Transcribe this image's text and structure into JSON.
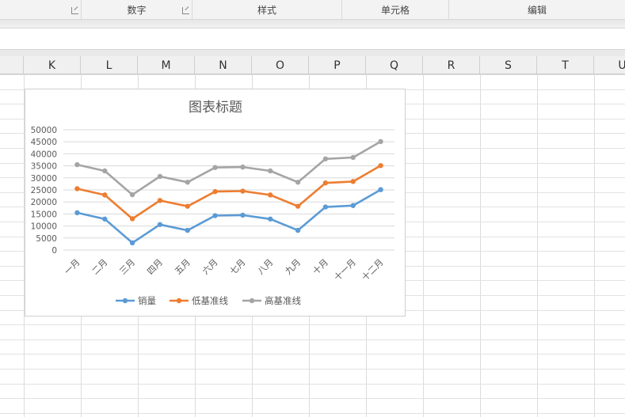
{
  "ribbon": {
    "groups": [
      {
        "label": "",
        "launcher": true
      },
      {
        "label": "数字",
        "launcher": true
      },
      {
        "label": "样式",
        "launcher": false
      },
      {
        "label": "单元格",
        "launcher": false
      },
      {
        "label": "编辑",
        "launcher": false
      }
    ]
  },
  "sheet": {
    "columns": [
      "K",
      "L",
      "M",
      "N",
      "O",
      "P",
      "Q",
      "R",
      "S",
      "T",
      "U"
    ]
  },
  "colors": {
    "series": [
      "#5b9bd5",
      "#ed7d31",
      "#a5a5a5"
    ],
    "grid": "#d9d9d9",
    "text": "#595959"
  },
  "chart_data": {
    "type": "line",
    "title": "图表标题",
    "categories": [
      "一月",
      "二月",
      "三月",
      "四月",
      "五月",
      "六月",
      "七月",
      "八月",
      "九月",
      "十月",
      "十一月",
      "十二月"
    ],
    "yticks": [
      "0",
      "5000",
      "10000",
      "15000",
      "20000",
      "25000",
      "30000",
      "35000",
      "40000",
      "45000",
      "50000"
    ],
    "ylim": [
      0,
      50000
    ],
    "grid": true,
    "legend": "bottom",
    "series": [
      {
        "name": "销量",
        "values": [
          15500,
          12900,
          3000,
          10600,
          8200,
          14300,
          14500,
          12900,
          8200,
          17900,
          18500,
          25100
        ]
      },
      {
        "name": "低基准线",
        "values": [
          25500,
          22900,
          13000,
          20600,
          18200,
          24300,
          24500,
          22900,
          18200,
          27900,
          28500,
          35100
        ]
      },
      {
        "name": "高基准线",
        "values": [
          35500,
          32900,
          23000,
          30600,
          28200,
          34300,
          34500,
          32900,
          28200,
          37900,
          38500,
          45100
        ]
      }
    ]
  }
}
